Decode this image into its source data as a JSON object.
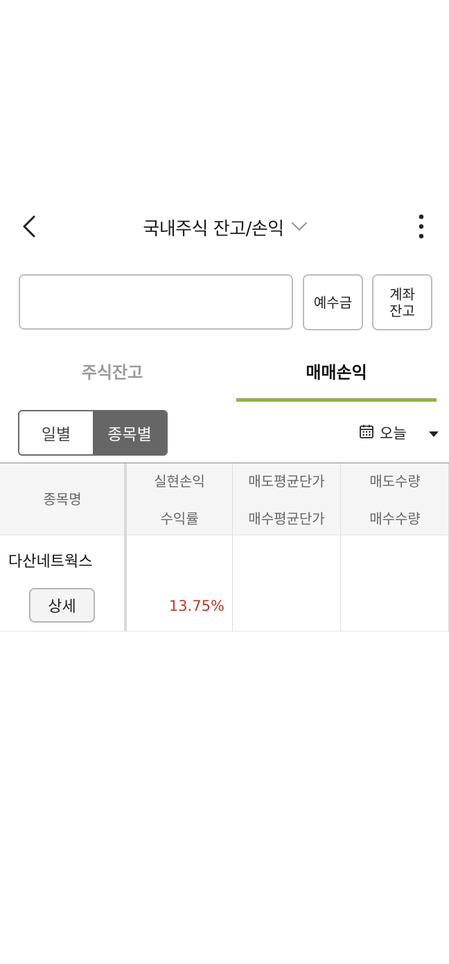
{
  "header": {
    "back_icon": "chevron-left-icon",
    "title": "국내주식 잔고/손익",
    "title_dropdown_icon": "chevron-down-icon",
    "more_icon": "vertical-dots-icon"
  },
  "account": {
    "select_value": "",
    "deposit_label": "예수금",
    "account_balance_label": "계좌\n잔고"
  },
  "tabs": [
    {
      "label": "주식잔고",
      "active": false
    },
    {
      "label": "매매손익",
      "active": true
    }
  ],
  "segment": {
    "daily_label": "일별",
    "by_stock_label": "종목별",
    "active": "종목별"
  },
  "date_filter": {
    "icon": "calendar-icon",
    "label": "오늘",
    "dropdown_icon": "caret-down-icon"
  },
  "table": {
    "headers": {
      "name": "종목명",
      "col1_top": "실현손익",
      "col1_bottom": "수익률",
      "col2_top": "매도평균단가",
      "col2_bottom": "매수평균단가",
      "col3_top": "매도수량",
      "col3_bottom": "매수수량"
    },
    "rows": [
      {
        "name": "다산네트웍스",
        "detail_label": "상세",
        "realized_pl": "",
        "return_rate": "13.75%",
        "sell_avg_price": "",
        "buy_avg_price": "",
        "sell_qty": "",
        "buy_qty": ""
      }
    ]
  },
  "colors": {
    "accent_underline": "#8eb052",
    "segment_active_bg": "#666666",
    "positive_rate": "#c0392b"
  }
}
